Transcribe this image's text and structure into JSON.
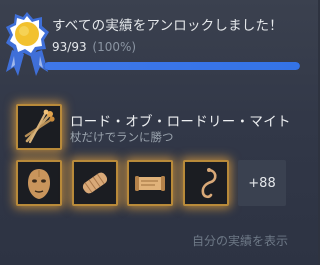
{
  "summary": {
    "title": "すべての実績をアンロックしました！",
    "count": "93/93",
    "percent": "(100%)",
    "progress_fraction": 1.0
  },
  "featured": {
    "name": "ロード・オブ・ロードリー・マイト",
    "description": "杖だけでランに勝つ",
    "icon": "crossed-staves-icon"
  },
  "recent_icons": [
    "mask-icon",
    "bandage-icon",
    "scroll-icon",
    "hook-icon"
  ],
  "more_count": "+88",
  "footer_link": "自分の実績を表示",
  "colors": {
    "background": "#323848",
    "progress": "#3473e6",
    "icon_glow": "#e3a03c",
    "badge_blue": "#3f6fd8",
    "badge_gold": "#f2c12e"
  }
}
